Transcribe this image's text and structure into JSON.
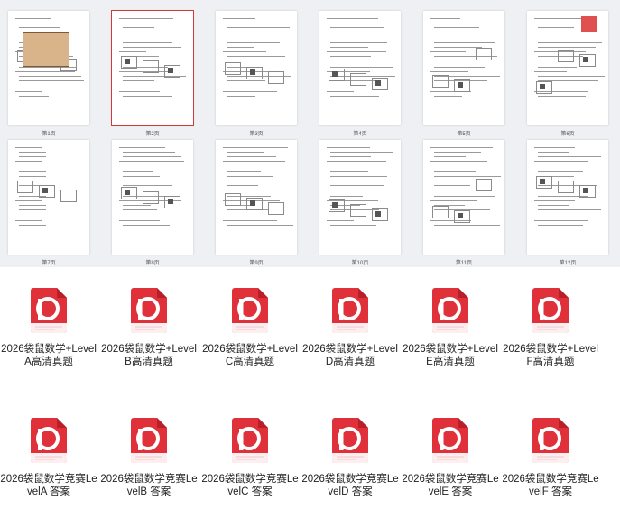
{
  "preview": {
    "page_labels": [
      "第1页",
      "第2页",
      "第3页",
      "第4页",
      "第5页",
      "第6页",
      "第7页",
      "第8页",
      "第9页",
      "第10页",
      "第11页",
      "第12页"
    ],
    "selected_page": 2
  },
  "files": [
    {
      "name": "2026袋鼠数学+LevelA高清真题",
      "icon": "pdf-file-icon"
    },
    {
      "name": "2026袋鼠数学+LevelB高清真题",
      "icon": "pdf-file-icon"
    },
    {
      "name": "2026袋鼠数学+LevelC高清真题",
      "icon": "pdf-file-icon"
    },
    {
      "name": "2026袋鼠数学+LevelD高清真题",
      "icon": "pdf-file-icon"
    },
    {
      "name": "2026袋鼠数学+LevelE高清真题",
      "icon": "pdf-file-icon"
    },
    {
      "name": "2026袋鼠数学+LevelF高清真题",
      "icon": "pdf-file-icon"
    },
    {
      "name": "2026袋鼠数学竞赛LevelA 答案",
      "icon": "pdf-file-icon"
    },
    {
      "name": "2026袋鼠数学竞赛LevelB 答案",
      "icon": "pdf-file-icon"
    },
    {
      "name": "2026袋鼠数学竞赛LevelC 答案",
      "icon": "pdf-file-icon"
    },
    {
      "name": "2026袋鼠数学竞赛LevelD 答案",
      "icon": "pdf-file-icon"
    },
    {
      "name": "2026袋鼠数学竞赛LevelE 答案",
      "icon": "pdf-file-icon"
    },
    {
      "name": "2026袋鼠数学竞赛LevelF 答案",
      "icon": "pdf-file-icon"
    }
  ],
  "colors": {
    "pdf_red": "#e0303a",
    "pdf_red_dark": "#b81f28",
    "selected_outline": "#d23a3a",
    "preview_bg": "#eef0f3"
  }
}
